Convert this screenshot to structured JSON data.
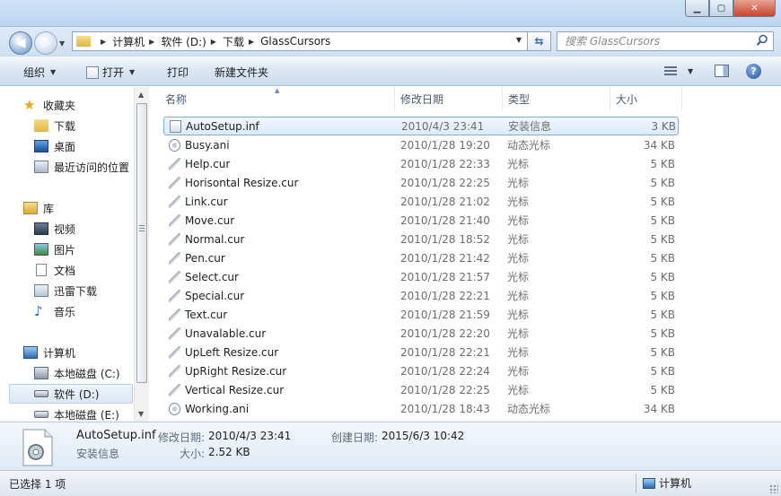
{
  "window": {
    "controls": {
      "minimize": "▁",
      "maximize": "▢",
      "close": "✕"
    }
  },
  "address": {
    "crumbs": [
      "计算机",
      "软件 (D:)",
      "下载",
      "GlassCursors"
    ]
  },
  "search": {
    "placeholder": "搜索 GlassCursors"
  },
  "commands": {
    "organize": "组织",
    "open": "打开",
    "print": "打印",
    "new_folder": "新建文件夹"
  },
  "nav": {
    "favorites": {
      "header": "收藏夹",
      "items": [
        "下载",
        "桌面",
        "最近访问的位置"
      ]
    },
    "libraries": {
      "header": "库",
      "items": [
        "视频",
        "图片",
        "文档",
        "迅雷下载",
        "音乐"
      ]
    },
    "computer": {
      "header": "计算机",
      "items": [
        "本地磁盘 (C:)",
        "软件 (D:)",
        "本地磁盘 (E:)"
      ]
    },
    "selected": "软件 (D:)"
  },
  "columns": {
    "name": "名称",
    "date": "修改日期",
    "type": "类型",
    "size": "大小"
  },
  "files": [
    {
      "name": "AutoSetup.inf",
      "date": "2010/4/3 23:41",
      "type": "安装信息",
      "size": "3 KB"
    },
    {
      "name": "Busy.ani",
      "date": "2010/1/28 19:20",
      "type": "动态光标",
      "size": "34 KB"
    },
    {
      "name": "Help.cur",
      "date": "2010/1/28 22:33",
      "type": "光标",
      "size": "5 KB"
    },
    {
      "name": "Horisontal Resize.cur",
      "date": "2010/1/28 22:25",
      "type": "光标",
      "size": "5 KB"
    },
    {
      "name": "Link.cur",
      "date": "2010/1/28 21:02",
      "type": "光标",
      "size": "5 KB"
    },
    {
      "name": "Move.cur",
      "date": "2010/1/28 21:40",
      "type": "光标",
      "size": "5 KB"
    },
    {
      "name": "Normal.cur",
      "date": "2010/1/28 18:52",
      "type": "光标",
      "size": "5 KB"
    },
    {
      "name": "Pen.cur",
      "date": "2010/1/28 21:42",
      "type": "光标",
      "size": "5 KB"
    },
    {
      "name": "Select.cur",
      "date": "2010/1/28 21:57",
      "type": "光标",
      "size": "5 KB"
    },
    {
      "name": "Special.cur",
      "date": "2010/1/28 22:21",
      "type": "光标",
      "size": "5 KB"
    },
    {
      "name": "Text.cur",
      "date": "2010/1/28 21:59",
      "type": "光标",
      "size": "5 KB"
    },
    {
      "name": "Unavalable.cur",
      "date": "2010/1/28 22:20",
      "type": "光标",
      "size": "5 KB"
    },
    {
      "name": "UpLeft Resize.cur",
      "date": "2010/1/28 22:21",
      "type": "光标",
      "size": "5 KB"
    },
    {
      "name": "UpRight Resize.cur",
      "date": "2010/1/28 22:24",
      "type": "光标",
      "size": "5 KB"
    },
    {
      "name": "Vertical Resize.cur",
      "date": "2010/1/28 22:25",
      "type": "光标",
      "size": "5 KB"
    },
    {
      "name": "Working.ani",
      "date": "2010/1/28 18:43",
      "type": "动态光标",
      "size": "34 KB"
    }
  ],
  "selected_file": "AutoSetup.inf",
  "details": {
    "filename": "AutoSetup.inf",
    "type": "安装信息",
    "modified_label": "修改日期:",
    "modified": "2010/4/3 23:41",
    "created_label": "创建日期:",
    "created": "2015/6/3 10:42",
    "size_label": "大小:",
    "size": "2.52 KB"
  },
  "status": {
    "selection": "已选择 1 项",
    "zone": "计算机"
  },
  "colors": {
    "selection_border": "#84acdd",
    "selection_fill": "#dbeafa",
    "chrome": "#cfe0f2"
  }
}
